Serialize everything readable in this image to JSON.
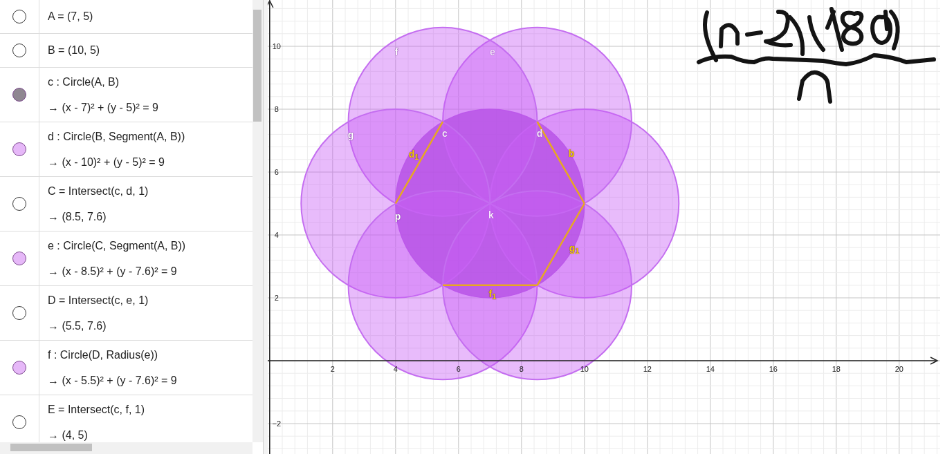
{
  "algebra": {
    "rows": [
      {
        "visible": false,
        "color": "#ffffff",
        "definition": "A = (7, 5)"
      },
      {
        "visible": false,
        "color": "#ffffff",
        "definition": "B = (10, 5)"
      },
      {
        "visible": true,
        "color": "#8f8791",
        "definition": "c : Circle(A, B)",
        "output": "→  (x - 7)² + (y - 5)² = 9"
      },
      {
        "visible": true,
        "color": "#e6b8f8",
        "definition": "d : Circle(B, Segment(A, B))",
        "output": "→  (x - 10)² + (y - 5)² = 9"
      },
      {
        "visible": false,
        "color": "#ffffff",
        "definition": "C = Intersect(c, d, 1)",
        "output": "→  (8.5, 7.6)"
      },
      {
        "visible": true,
        "color": "#e6b8f8",
        "definition": "e : Circle(C, Segment(A, B))",
        "output": "→  (x - 8.5)² + (y - 7.6)² = 9"
      },
      {
        "visible": false,
        "color": "#ffffff",
        "definition": "D = Intersect(c, e, 1)",
        "output": "→  (5.5, 7.6)"
      },
      {
        "visible": true,
        "color": "#e6b8f8",
        "definition": "f : Circle(D, Radius(e))",
        "output": "→  (x - 5.5)² + (y - 7.6)² = 9"
      },
      {
        "visible": false,
        "color": "#ffffff",
        "definition": "E = Intersect(c, f, 1)",
        "output": "→  (4, 5)"
      }
    ]
  },
  "graphics": {
    "x_ticks": [
      "2",
      "4",
      "6",
      "8",
      "10",
      "12",
      "14",
      "16",
      "18",
      "20"
    ],
    "y_ticks": [
      "10",
      "8",
      "6",
      "4",
      "2",
      "−2"
    ],
    "labels": [
      {
        "text": "f",
        "kind": "object"
      },
      {
        "text": "e",
        "kind": "faint"
      },
      {
        "text": "g",
        "kind": "object"
      },
      {
        "text": "c",
        "kind": "faint"
      },
      {
        "text": "d",
        "kind": "faint"
      },
      {
        "text": "d$_{1}$",
        "kind": "segment"
      },
      {
        "text": "b",
        "kind": "segment"
      },
      {
        "text": "p",
        "kind": "object"
      },
      {
        "text": "k",
        "kind": "faint"
      },
      {
        "text": "g$_{1}$",
        "kind": "segment"
      },
      {
        "text": "f$_{1}$",
        "kind": "segment"
      }
    ]
  }
}
